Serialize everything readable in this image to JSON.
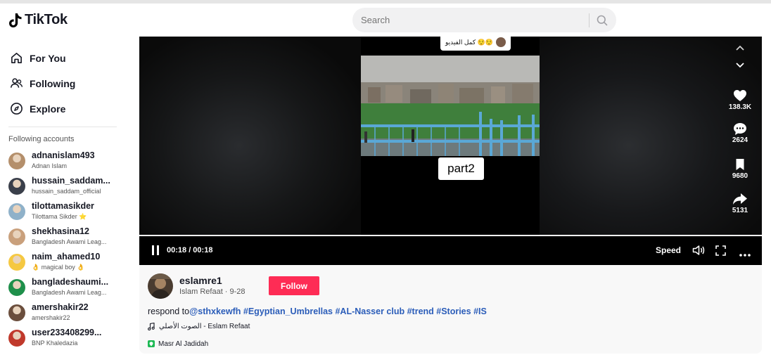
{
  "header": {
    "logo_text": "TikTok",
    "search_placeholder": "Search"
  },
  "sidebar": {
    "nav": [
      {
        "label": "For You",
        "icon": "home-icon"
      },
      {
        "label": "Following",
        "icon": "following-icon"
      },
      {
        "label": "Explore",
        "icon": "compass-icon"
      }
    ],
    "following_heading": "Following accounts",
    "accounts": [
      {
        "username": "adnanislam493",
        "display_name": "Adnan Islam",
        "avatar_color": "#b48f6b"
      },
      {
        "username": "hussain_saddam...",
        "display_name": "hussain_saddam_official",
        "avatar_color": "#3a3f4a"
      },
      {
        "username": "tilottamasikder",
        "display_name": "Tilottama Sikder ⭐",
        "avatar_color": "#8fb1c9"
      },
      {
        "username": "shekhasina12",
        "display_name": "Bangladesh Awami Leag...",
        "avatar_color": "#c9a07c"
      },
      {
        "username": "naim_ahamed10",
        "display_name": "👌 magical boy 👌",
        "avatar_color": "#f5c842"
      },
      {
        "username": "bangladeshaumi...",
        "display_name": "Bangladesh Awami Leag...",
        "avatar_color": "#1e8f4a"
      },
      {
        "username": "amershakir22",
        "display_name": "amershakir22",
        "avatar_color": "#6b4e3d"
      },
      {
        "username": "user233408299...",
        "display_name": "BNP Khaledazia",
        "avatar_color": "#c0392b"
      }
    ]
  },
  "video": {
    "caption_overlay": "كمل الفيديو 😌😌",
    "part_label": "part2",
    "time": "00:18 / 00:18",
    "speed_label": "Speed",
    "progress_fraction": 1.0,
    "actions": {
      "likes": "138.3K",
      "comments": "2624",
      "saves": "9680",
      "shares": "5131"
    }
  },
  "post": {
    "author_username": "eslamre1",
    "author_sub": "Islam Refaat · 9-28",
    "follow_label": "Follow",
    "description_prefix": "respond to",
    "description_tags": "@sthxkewfh #Egyptian_Umbrellas #AL-Nasser club #trend #Stories #IS",
    "sound": "الصوت الأصلي - Eslam Refaat",
    "location": "Masr Al Jadidah"
  },
  "colors": {
    "follow_button": "#fe2c55",
    "hashtag": "#2b5db9",
    "location_pin": "#1db954"
  }
}
